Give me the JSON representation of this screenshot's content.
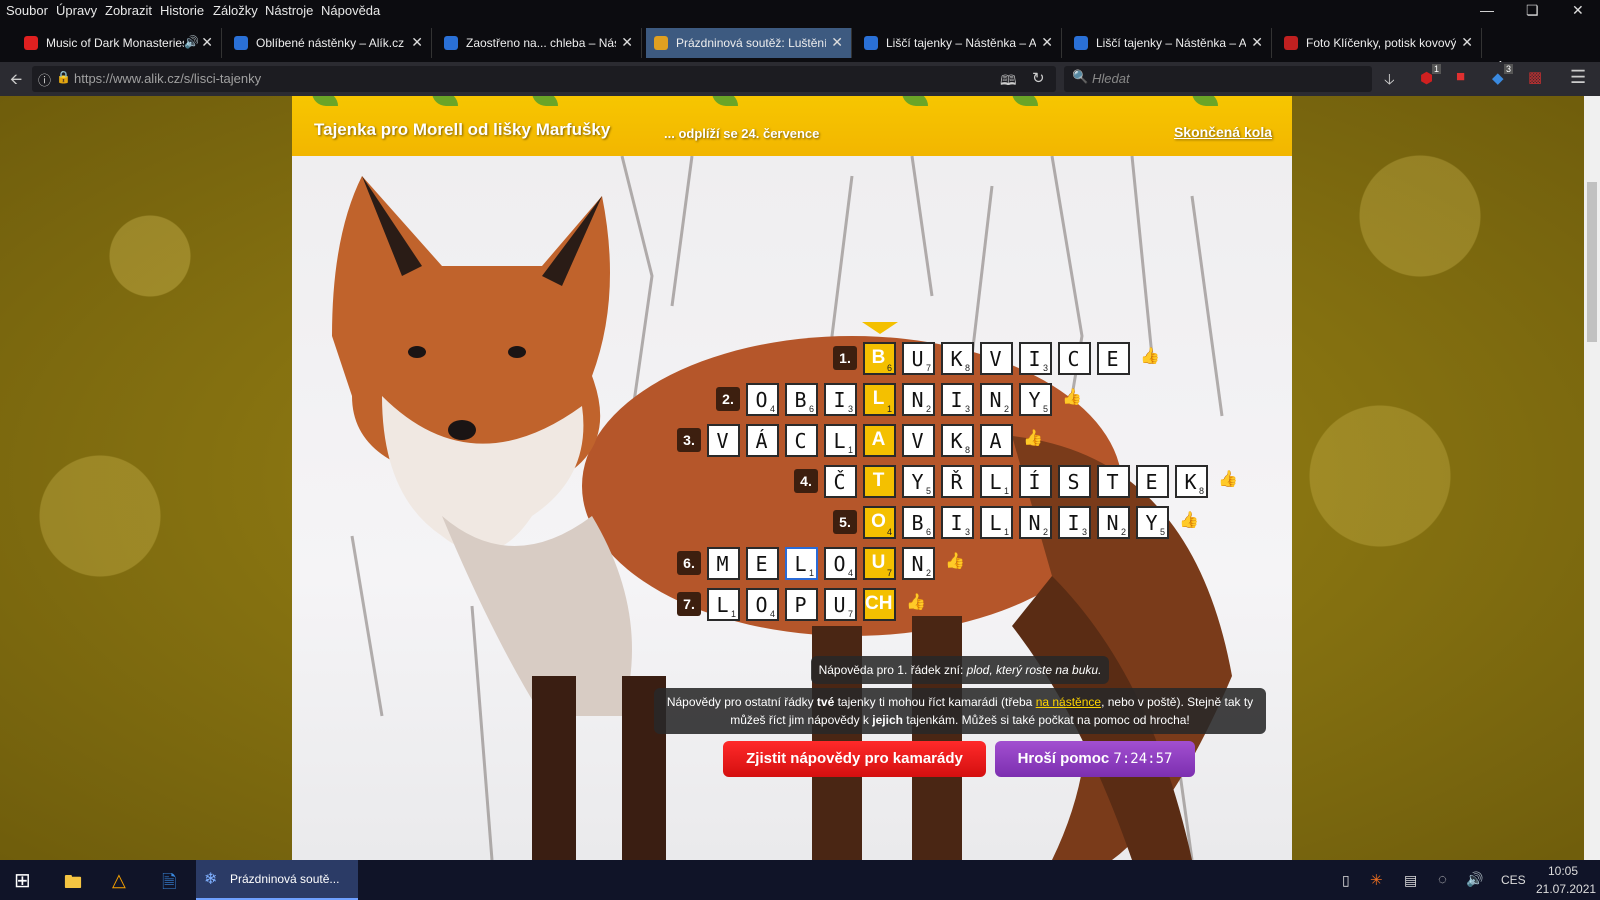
{
  "menubar": {
    "items": [
      "Soubor",
      "Úpravy",
      "Zobrazit",
      "Historie",
      "Záložky",
      "Nástroje",
      "Nápověda"
    ]
  },
  "tabs": [
    {
      "title": "Music of Dark Monasteries",
      "color": "#e02020"
    },
    {
      "title": "Oblíbené nástěnky – Alík.cz",
      "color": "#2a70d6"
    },
    {
      "title": "Zaostřeno na... chleba – Nást",
      "color": "#2a70d6"
    },
    {
      "title": "Prázdninová soutěž: Luštění",
      "color": "#e0a020",
      "active": true
    },
    {
      "title": "Liščí tajenky – Nástěnka – Al",
      "color": "#2a70d6"
    },
    {
      "title": "Liščí tajenky – Nástěnka – Al",
      "color": "#2a70d6"
    },
    {
      "title": "Foto Klíčenky, potisk kovový",
      "color": "#c02020"
    }
  ],
  "navbar": {
    "url": "https://www.alik.cz/s/lisci-tajenky",
    "search_placeholder": "Hledat",
    "badges": [
      "1",
      "3"
    ]
  },
  "banner": {
    "title": "Tajenka pro Morell od lišky Marfušky",
    "subtitle": "... odplíží se 24. července",
    "link": "Skončená kola"
  },
  "puzzle": {
    "rows": [
      {
        "num": "1.",
        "cells": [
          [
            "B",
            "6"
          ],
          [
            "U",
            "7"
          ],
          [
            "K",
            "8"
          ],
          [
            "V",
            ""
          ],
          [
            "I",
            "3"
          ],
          [
            "C",
            ""
          ],
          [
            "E",
            ""
          ]
        ],
        "hl": 0
      },
      {
        "num": "2.",
        "cells": [
          [
            "O",
            "4"
          ],
          [
            "B",
            "6"
          ],
          [
            "I",
            "3"
          ],
          [
            "L",
            "1"
          ],
          [
            "N",
            "2"
          ],
          [
            "I",
            "3"
          ],
          [
            "N",
            "2"
          ],
          [
            "Y",
            "5"
          ]
        ],
        "hl": 3
      },
      {
        "num": "3.",
        "cells": [
          [
            "V",
            ""
          ],
          [
            "Á",
            ""
          ],
          [
            "C",
            ""
          ],
          [
            "L",
            "1"
          ],
          [
            "A",
            ""
          ],
          [
            "V",
            ""
          ],
          [
            "K",
            "8"
          ],
          [
            "A",
            ""
          ]
        ],
        "hl": 4
      },
      {
        "num": "4.",
        "cells": [
          [
            "Č",
            ""
          ],
          [
            "T",
            ""
          ],
          [
            "Y",
            "5"
          ],
          [
            "Ř",
            ""
          ],
          [
            "L",
            "1"
          ],
          [
            "Í",
            ""
          ],
          [
            "S",
            ""
          ],
          [
            "T",
            ""
          ],
          [
            "E",
            ""
          ],
          [
            "K",
            "8"
          ]
        ],
        "hl": 1
      },
      {
        "num": "5.",
        "cells": [
          [
            "O",
            "4"
          ],
          [
            "B",
            "6"
          ],
          [
            "I",
            "3"
          ],
          [
            "L",
            "1"
          ],
          [
            "N",
            "2"
          ],
          [
            "I",
            "3"
          ],
          [
            "N",
            "2"
          ],
          [
            "Y",
            "5"
          ]
        ],
        "hl": 0
      },
      {
        "num": "6.",
        "cells": [
          [
            "M",
            ""
          ],
          [
            "E",
            ""
          ],
          [
            "L",
            "1"
          ],
          [
            "O",
            "4"
          ],
          [
            "U",
            "7"
          ],
          [
            "N",
            "2"
          ]
        ],
        "hl": 4,
        "sel": 2
      },
      {
        "num": "7.",
        "cells": [
          [
            "L",
            "1"
          ],
          [
            "O",
            "4"
          ],
          [
            "P",
            ""
          ],
          [
            "U",
            "7"
          ],
          [
            "CH",
            ""
          ]
        ],
        "hl": 4
      }
    ]
  },
  "hint1": {
    "prefix": "Nápověda pro 1. řádek zní:",
    "text": "plod, který roste na buku."
  },
  "hint2": {
    "a": "Nápovědy pro ostatní řádky ",
    "b": "tvé",
    "c": " tajenky ti mohou říct kamarádi (třeba ",
    "link": "na nástěnce",
    "d": ", nebo v poště). Stejně tak ty",
    "e": "můžeš říct jim nápovědy k ",
    "f": "jejich",
    "g": " tajenkám. Můžeš si také počkat na pomoc od hrocha!"
  },
  "buttons": {
    "friends": "Zjistit nápovědy pro kamarády",
    "hippo": "Hroší pomoc",
    "timer": "7:24:57"
  },
  "taskbar": {
    "active_title": "Prázdninová soutě...",
    "lang": "CES",
    "time": "10:05",
    "date": "21.07.2021"
  }
}
